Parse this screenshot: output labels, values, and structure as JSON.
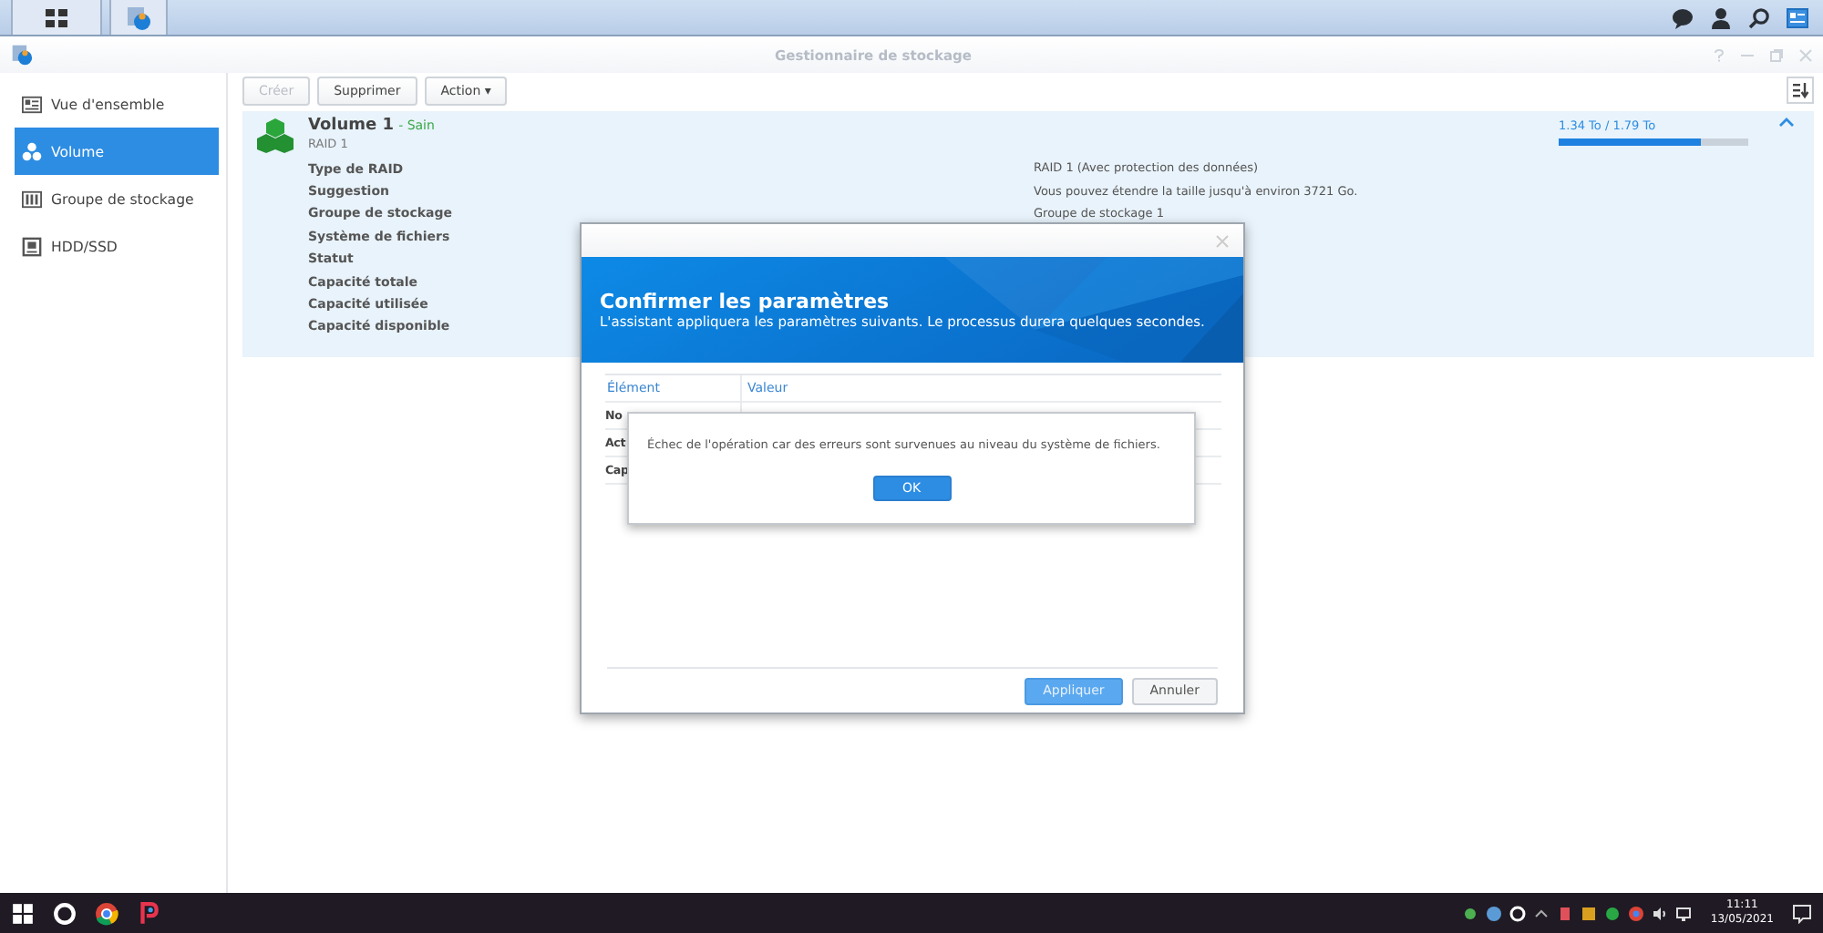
{
  "window": {
    "title": "Gestionnaire de stockage"
  },
  "sidebar": {
    "items": [
      {
        "label": "Vue d'ensemble",
        "selected": false,
        "kind": "overview"
      },
      {
        "label": "Volume",
        "selected": true,
        "kind": "volume"
      },
      {
        "label": "Groupe de stockage",
        "selected": false,
        "kind": "pool"
      },
      {
        "label": "HDD/SSD",
        "selected": false,
        "kind": "disk"
      }
    ]
  },
  "toolbar": {
    "buttons": [
      {
        "label": "Créer",
        "disabled": true
      },
      {
        "label": "Supprimer",
        "disabled": false
      },
      {
        "label": "Action ▾",
        "disabled": false
      }
    ]
  },
  "volume": {
    "name": "Volume 1",
    "status": "- Sain",
    "subtitle": "RAID 1",
    "usage": "1.34 To / 1.79 To",
    "level": 0.75,
    "expanded": true,
    "details": [
      {
        "label": "Type de RAID",
        "value": "RAID 1 (Avec protection des données)"
      },
      {
        "label": "Suggestion",
        "value": "Vous pouvez étendre la taille jusqu'à environ 3721 Go."
      },
      {
        "label": "Groupe de stockage",
        "value": "Groupe de stockage 1"
      },
      {
        "label": "Système de fichiers"
      },
      {
        "label": "Statut"
      },
      {
        "label": "Capacité totale"
      },
      {
        "label": "Capacité utilisée"
      },
      {
        "label": "Capacité disponible"
      }
    ]
  },
  "dialog": {
    "title": "Confirmer les paramètres",
    "subtitle": "L'assistant appliquera les paramètres suivants. Le processus durera quelques secondes.",
    "table": {
      "columns": [
        "Élément",
        "Valeur"
      ],
      "rows": [
        [
          "No"
        ],
        [
          "Act"
        ],
        [
          "Cap"
        ]
      ]
    },
    "buttons": [
      {
        "label": "Appliquer",
        "primary": true
      },
      {
        "label": "Annuler",
        "primary": false
      }
    ]
  },
  "alert": {
    "message": "Échec de l'opération car des erreurs sont survenues au niveau du système de fichiers.",
    "button": "OK"
  },
  "taskbar": {
    "time": "11:11",
    "date": "13/05/2021"
  }
}
